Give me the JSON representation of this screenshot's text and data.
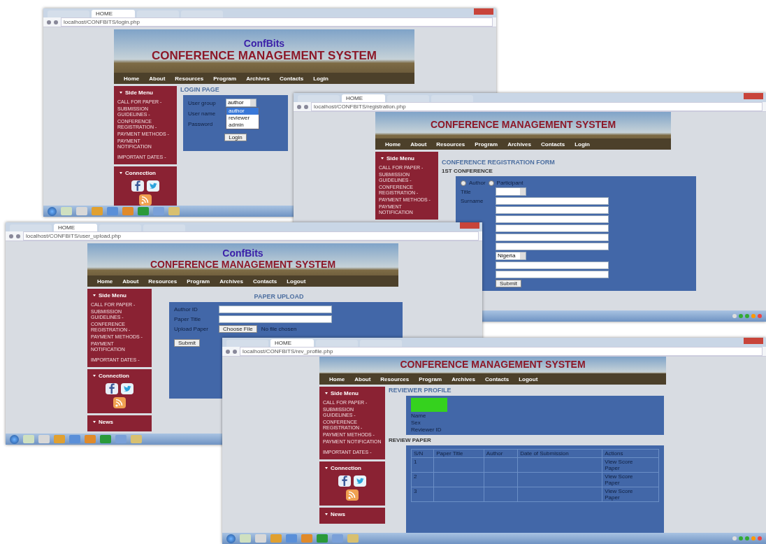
{
  "windows": [
    {
      "kind": "login",
      "tabs": [
        {
          "label": "HOME",
          "selected": true
        }
      ],
      "address": "localhost/CONFBITS/login.php",
      "banner": {
        "brand": "ConfBits",
        "title": "CONFERENCE MANAGEMENT SYSTEM"
      },
      "nav": [
        "Home",
        "About",
        "Resources",
        "Program",
        "Archives",
        "Contacts",
        "Login"
      ],
      "side_menu": {
        "title": "Side Menu",
        "items": [
          "CALL FOR PAPER -",
          "SUBMISSION GUIDELINES -",
          "CONFERENCE REGISTRATION -",
          "PAYMENT METHODS -",
          "PAYMENT NOTIFICATION",
          "IMPORTANT DATES -"
        ]
      },
      "connection": {
        "title": "Connection"
      },
      "heading": "LOGIN PAGE",
      "form": {
        "fields": [
          {
            "label": "User group",
            "kind": "select",
            "value": "author"
          },
          {
            "label": "User name",
            "kind": "text"
          },
          {
            "label": "Password",
            "kind": "text"
          }
        ],
        "options": [
          {
            "label": "author",
            "selected": true
          },
          {
            "label": "reviewer",
            "selected": false
          },
          {
            "label": "admin",
            "selected": false
          }
        ],
        "button": "Login"
      },
      "taskbar": true
    },
    {
      "kind": "registration",
      "tabs": [
        {
          "label": "HOME",
          "selected": true
        }
      ],
      "address": "localhost/CONFBITS/registration.php",
      "banner": {
        "title": "CONFERENCE MANAGEMENT SYSTEM"
      },
      "nav": [
        "Home",
        "About",
        "Resources",
        "Program",
        "Archives",
        "Contacts",
        "Login"
      ],
      "side_menu": {
        "title": "Side Menu",
        "items": [
          "CALL FOR PAPER -",
          "SUBMISSION GUIDELINES -",
          "CONFERENCE REGISTRATION -",
          "PAYMENT METHODS -",
          "PAYMENT NOTIFICATION"
        ]
      },
      "heading": "CONFERENCE REGISTRATION FORM",
      "subheading": "1ST CONFERENCE",
      "form": {
        "roles": [
          {
            "label": "Author",
            "selected": false
          },
          {
            "label": "Participant",
            "selected": false
          }
        ],
        "fields": [
          {
            "label": "Title",
            "kind": "select"
          },
          {
            "label": "Surname",
            "kind": "text"
          },
          {
            "kind": "text"
          },
          {
            "kind": "text"
          },
          {
            "kind": "text"
          },
          {
            "kind": "text"
          },
          {
            "kind": "text"
          },
          {
            "kind": "select",
            "value": "Nigeria"
          },
          {
            "kind": "text"
          },
          {
            "kind": "text"
          }
        ],
        "button": "Submit"
      },
      "taskbar": true
    },
    {
      "kind": "upload",
      "tabs": [
        {
          "label": "HOME",
          "selected": true
        }
      ],
      "address": "localhost/CONFBITS/user_upload.php",
      "banner": {
        "brand": "ConfBits",
        "title": "CONFERENCE MANAGEMENT SYSTEM"
      },
      "nav": [
        "Home",
        "About",
        "Resources",
        "Program",
        "Archives",
        "Contacts",
        "Logout"
      ],
      "side_menu": {
        "title": "Side Menu",
        "items": [
          "CALL FOR PAPER -",
          "SUBMISSION GUIDELINES -",
          "CONFERENCE REGISTRATION -",
          "PAYMENT METHODS -",
          "PAYMENT NOTIFICATION",
          "IMPORTANT DATES -"
        ]
      },
      "connection": {
        "title": "Connection"
      },
      "news": {
        "title": "News"
      },
      "heading": "PAPER UPLOAD",
      "form": {
        "fields": [
          {
            "label": "Author ID",
            "kind": "text"
          },
          {
            "label": "Paper Title",
            "kind": "text"
          },
          {
            "label": "Upload Paper",
            "kind": "file",
            "button": "Choose File",
            "value": "No file chosen"
          }
        ],
        "button": "Submit"
      },
      "taskbar": true
    },
    {
      "kind": "reviewer",
      "tabs": [
        {
          "label": "HOME",
          "selected": true
        }
      ],
      "address": "localhost/CONFBITS/rev_profile.php",
      "banner": {
        "title": "CONFERENCE MANAGEMENT SYSTEM"
      },
      "nav": [
        "Home",
        "About",
        "Resources",
        "Program",
        "Archives",
        "Contacts",
        "Logout"
      ],
      "side_menu": {
        "title": "Side Menu",
        "items": [
          "CALL FOR PAPER -",
          "SUBMISSION GUIDELINES -",
          "CONFERENCE REGISTRATION -",
          "PAYMENT METHODS -",
          "PAYMENT NOTIFICATION",
          "IMPORTANT DATES -"
        ]
      },
      "connection": {
        "title": "Connection"
      },
      "news": {
        "title": "News"
      },
      "heading": "REVIEWER PROFILE",
      "profile": {
        "fields": [
          "Name",
          "Sex",
          "Reviewer ID"
        ]
      },
      "subheading": "REVIEW PAPER",
      "table": {
        "columns": [
          "S/N",
          "Paper Title",
          "Author",
          "Date of Submission",
          "Actions"
        ],
        "rows": [
          [
            "1",
            "",
            "",
            "",
            "View Score Paper"
          ],
          [
            "2",
            "",
            "",
            "",
            "View Score Paper"
          ],
          [
            "3",
            "",
            "",
            "",
            "View Score Paper"
          ]
        ]
      },
      "taskbar": true
    }
  ]
}
